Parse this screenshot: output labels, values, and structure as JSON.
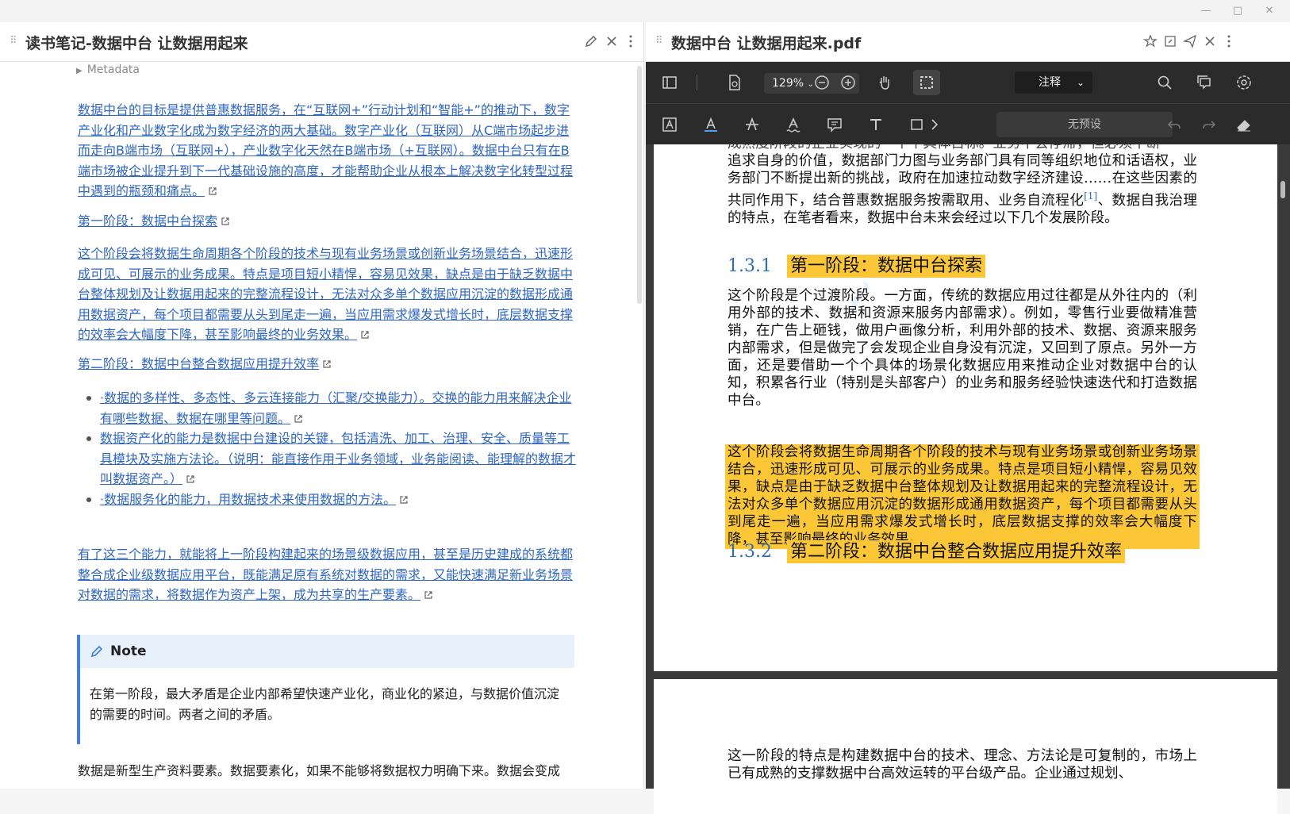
{
  "window": {
    "minimize": "—",
    "maximize": "□",
    "close": "✕"
  },
  "left_pane": {
    "title": "读书笔记-数据中台 让数据用起来",
    "metadata_label": "Metadata",
    "p1": "数据中台的目标是提供普惠数据服务，在“互联网+”行动计划和“智能+”的推动下，数字产业化和产业数字化成为数字经济的两大基础。数字产业化（互联网）从C端市场起步进而走向B端市场（互联网+），产业数字化天然在B端市场（+互联网）。数据中台只有在B端市场被企业提升到下一代基础设施的高度，才能帮助企业从根本上解决数字化转型过程中遇到的瓶颈和痛点。",
    "h1": "第一阶段：数据中台探索",
    "p2": "这个阶段会将数据生命周期各个阶段的技术与现有业务场景或创新业务场景结合，迅速形成可见、可展示的业务成果。特点是项目短小精悍，容易见效果，缺点是由于缺乏数据中台整体规划及让数据用起来的完整流程设计，无法对众多单个数据应用沉淀的数据形成通用数据资产，每个项目都需要从头到尾走一遍，当应用需求爆发式增长时，底层数据支撑的效率会大幅度下降，甚至影响最终的业务效果。",
    "h2": "第二阶段：数据中台整合数据应用提升效率",
    "bullets": [
      "·数据的多样性、多态性、多云连接能力（汇聚/交换能力）。交换的能力用来解决企业有哪些数据、数据在哪里等问题。",
      "数据资产化的能力是数据中台建设的关键，包括清洗、加工、治理、安全、质量等工具模块及实施方法论。（说明：能直接作用于业务领域，业务能阅读、能理解的数据才叫数据资产。）",
      "·数据服务化的能力，用数据技术来使用数据的方法。"
    ],
    "p3": "有了这三个能力，就能将上一阶段构建起来的场景级数据应用，甚至是历史建成的系统都整合成企业级数据应用平台，既能满足原有系统对数据的需求，又能快速满足新业务场景对数据的需求，将数据作为资产上架，成为共享的生产要素。",
    "note_title": "Note",
    "note_body": "在第一阶段，最大矛盾是企业内部希望快速产业化，商业化的紧迫，与数据价值沉淀的需要的时间。两者之间的矛盾。",
    "p4": "数据是新型生产资料要素。数据要素化，如果不能够将数据权力明确下来。数据会变成"
  },
  "right_pane": {
    "title": "数据中台 让数据用起来.pdf",
    "zoom": "129%",
    "mode": "注释",
    "preset": "无预设",
    "pdf": {
      "top_cut": "成熟度阶段的企业实现的一个个具体目标。业务不会停滞，但必须不断",
      "top_para": "追求自身的价值，数据部门力图与业务部门具有同等组织地位和话语权，业务部门不断提出新的挑战，政府在加速拉动数字经济建设……在这些因素的共同作用下，结合普惠数据服务按需取用、业务自流程化",
      "fn": "[1]",
      "top_para_end": "、数据自我治理的特点，在笔者看来，数据中台未来会经过以下几个发展阶段。",
      "sec1_num": "1.3.1",
      "sec1_title": "第一阶段：数据中台探索",
      "para1": "这个阶段是个过渡阶段。一方面，传统的数据应用过往都是从外往内的（利用外部的技术、数据和资源来服务内部需求）。例如，零售行业要做精准营销，在广告上砸钱，做用户画像分析，利用外部的技术、数据、资源来服务内部需求，但是做完了会发现企业自身没有沉淀，又回到了原点。另外一方面，还是要借助一个个具体的场景化数据应用来推动企业对数据中台的认知，积累各行业（特别是头部客户）的业务和服务经验快速迭代和打造数据中台。",
      "para2": "这个阶段会将数据生命周期各个阶段的技术与现有业务场景或创新业务场景结合，迅速形成可见、可展示的业务成果。特点是项目短小精悍，容易见效果，缺点是由于缺乏数据中台整体规划及让数据用起来的完整流程设计，无法对众多单个数据应用沉淀的数据形成通用数据资产，每个项目都需要从头到尾走一遍，当应用需求爆发式增长时，底层数据支撑的效率会大幅度下降，甚至影响最终的业务效果。",
      "sec2_num": "1.3.2",
      "sec2_title": "第二阶段：数据中台整合数据应用提升效率",
      "page2_para": "这一阶段的特点是构建数据中台的技术、理念、方法论是可复制的，市场上已有成熟的支撑数据中台高效运转的平台级产品。企业通过规划、"
    }
  },
  "colors": {
    "link": "#2f66c2",
    "highlight": "#fcc736",
    "note_accent": "#3d7ee0",
    "pdf_heading": "#2e6db4"
  }
}
